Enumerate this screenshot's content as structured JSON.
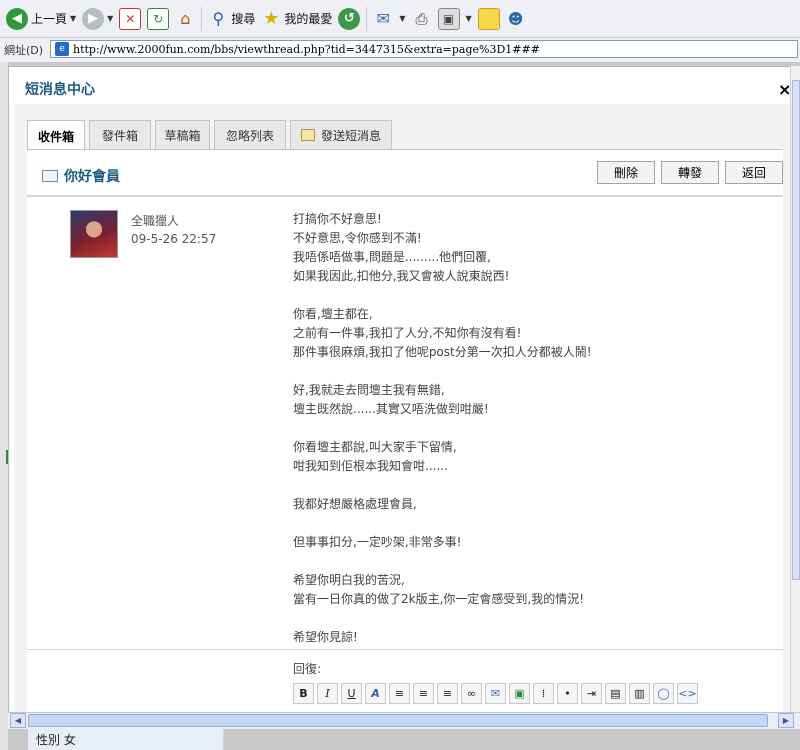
{
  "toolbar": {
    "back_label": "上一頁",
    "search_label": "搜尋",
    "favorites_label": "我的最愛"
  },
  "address": {
    "label": "網址(D)",
    "url": "http://www.2000fun.com/bbs/viewthread.php?tid=3447315&extra=page%3D1###"
  },
  "dialog": {
    "title": "短消息中心",
    "close": "×"
  },
  "tabs": [
    {
      "label": "收件箱",
      "active": true
    },
    {
      "label": "發件箱",
      "active": false
    },
    {
      "label": "草稿箱",
      "active": false
    },
    {
      "label": "忽略列表",
      "active": false
    },
    {
      "label": "發送短消息",
      "active": false
    }
  ],
  "section": {
    "title": "你好會員",
    "buttons": {
      "delete": "刪除",
      "forward": "轉發",
      "back": "返回"
    }
  },
  "message": {
    "sender": "全職獵人",
    "date": "09-5-26 22:57",
    "lines": [
      "打搞你不好意思!",
      "不好意思,令你感到不滿!",
      "我唔係唔做事,問題是.........他們回覆,",
      "如果我因此,扣他分,我又會被人說東說西!",
      "",
      "你看,壇主都在,",
      "之前有一件事,我扣了人分,不知你有沒有看!",
      "那件事很麻煩,我扣了他呢post分第一次扣人分都被人鬧!",
      "",
      "好,我就走去問壇主我有無錯,",
      "壇主既然說......其實又唔洗做到咁嚴!",
      "",
      "你看壇主都說,叫大家手下留情,",
      "咁我知到佢根本我知會咁......",
      "",
      "我都好想嚴格處理會員,",
      "",
      "但事事扣分,一定吵架,非常多事!",
      "",
      "希望你明白我的苦況,",
      "當有一日你真的做了2k版主,你一定會感受到,我的情況!",
      "",
      "希望你見諒!"
    ]
  },
  "reply": {
    "label": "回復:"
  },
  "below": {
    "text": "性別  女"
  }
}
